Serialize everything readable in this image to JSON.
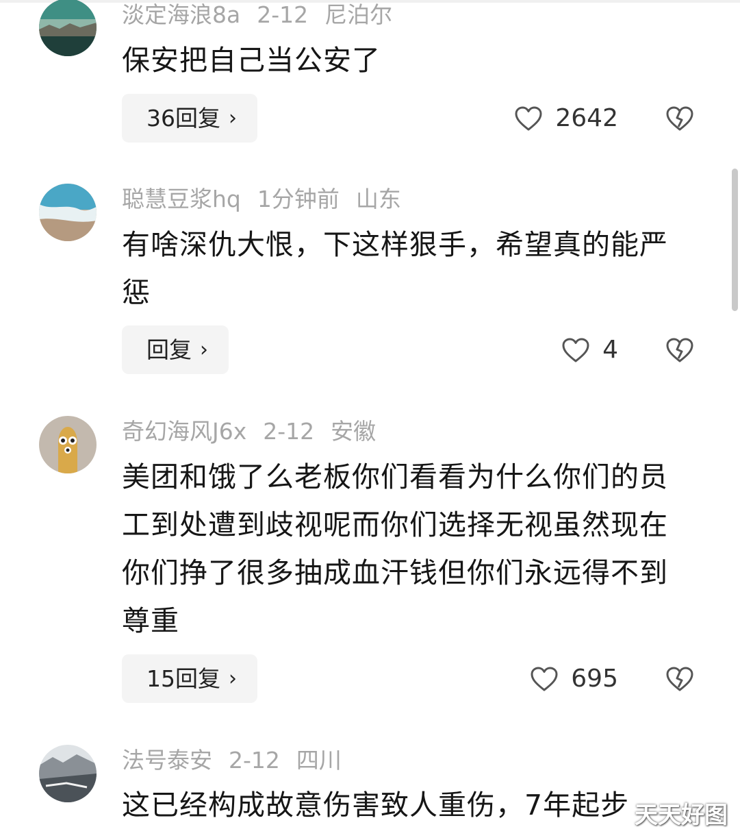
{
  "comments": [
    {
      "username": "淡定海浪8a",
      "date": "2-12",
      "location": "尼泊尔",
      "text": "保安把自己当公安了",
      "reply_label": "36回复",
      "likes": "2642"
    },
    {
      "username": "聪慧豆浆hq",
      "date": "1分钟前",
      "location": "山东",
      "text": "有啥深仇大恨，下这样狠手，希望真的能严惩",
      "reply_label": "回复",
      "likes": "4"
    },
    {
      "username": "奇幻海风J6x",
      "date": "2-12",
      "location": "安徽",
      "text": "美团和饿了么老板你们看看为什么你们的员工到处遭到歧视呢而你们选择无视虽然现在你们挣了很多抽成血汗钱但你们永远得不到尊重",
      "reply_label": "15回复",
      "likes": "695"
    },
    {
      "username": "法号泰安",
      "date": "2-12",
      "location": "四川",
      "text": "这已经构成故意伤害致人重伤，7年起步"
    }
  ],
  "icons": {
    "chevron": "›",
    "like": "heart-outline-icon",
    "dislike": "broken-heart-icon"
  },
  "watermark": "天天好图",
  "colors": {
    "meta_text": "#a6a6a6",
    "reply_bg": "#f4f4f4",
    "body_text": "#161616"
  }
}
